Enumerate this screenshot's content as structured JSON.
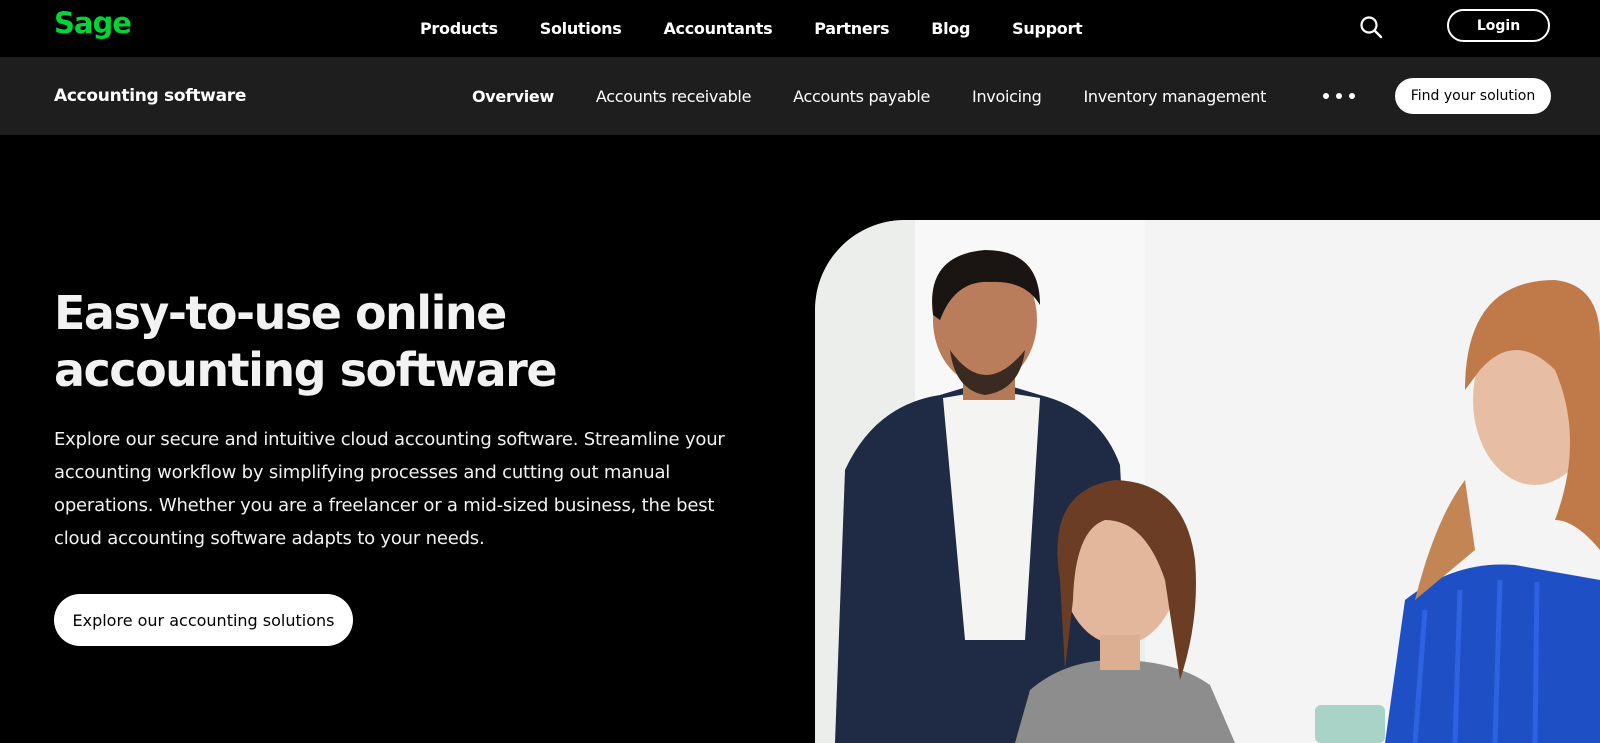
{
  "brand": {
    "name": "Sage",
    "color": "#00d639"
  },
  "topnav": {
    "items": [
      "Products",
      "Solutions",
      "Accountants",
      "Partners",
      "Blog",
      "Support"
    ],
    "search_icon": "search-icon",
    "login_label": "Login"
  },
  "subnav": {
    "title": "Accounting software",
    "items": [
      "Overview",
      "Accounts receivable",
      "Accounts payable",
      "Invoicing",
      "Inventory management"
    ],
    "active": "Overview",
    "more_icon": "more-horizontal-icon",
    "cta_label": "Find your solution"
  },
  "hero": {
    "title_line1": "Easy-to-use online",
    "title_line2": "accounting software",
    "description": "Explore our secure and intuitive cloud accounting software. Streamline your accounting workflow by simplifying processes and cutting out manual operations. Whether you are a freelancer or a mid-sized business, the best cloud accounting software adapts to your needs.",
    "cta_label": "Explore our accounting solutions"
  },
  "colors": {
    "background": "#000000",
    "subnav_bg": "#1e1e1e",
    "accent": "#00d639"
  }
}
